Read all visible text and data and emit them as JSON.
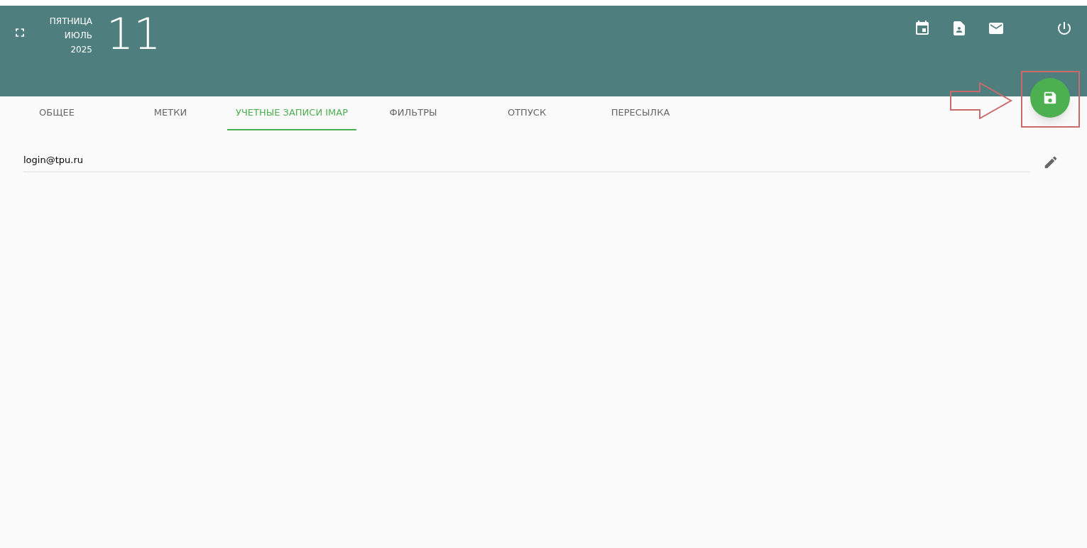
{
  "header": {
    "weekday": "ПЯТНИЦА",
    "month": "ИЮЛЬ",
    "year": "2025",
    "day": "11"
  },
  "tabs": [
    {
      "label": "ОБЩЕЕ",
      "selected": false
    },
    {
      "label": "МЕТКИ",
      "selected": false
    },
    {
      "label": "УЧЕТНЫЕ ЗАПИСИ IMAP",
      "selected": true
    },
    {
      "label": "ФИЛЬТРЫ",
      "selected": false
    },
    {
      "label": "ОТПУСК",
      "selected": false
    },
    {
      "label": "ПЕРЕСЫЛКА",
      "selected": false
    }
  ],
  "accounts": [
    {
      "email": "login@tpu.ru"
    }
  ]
}
